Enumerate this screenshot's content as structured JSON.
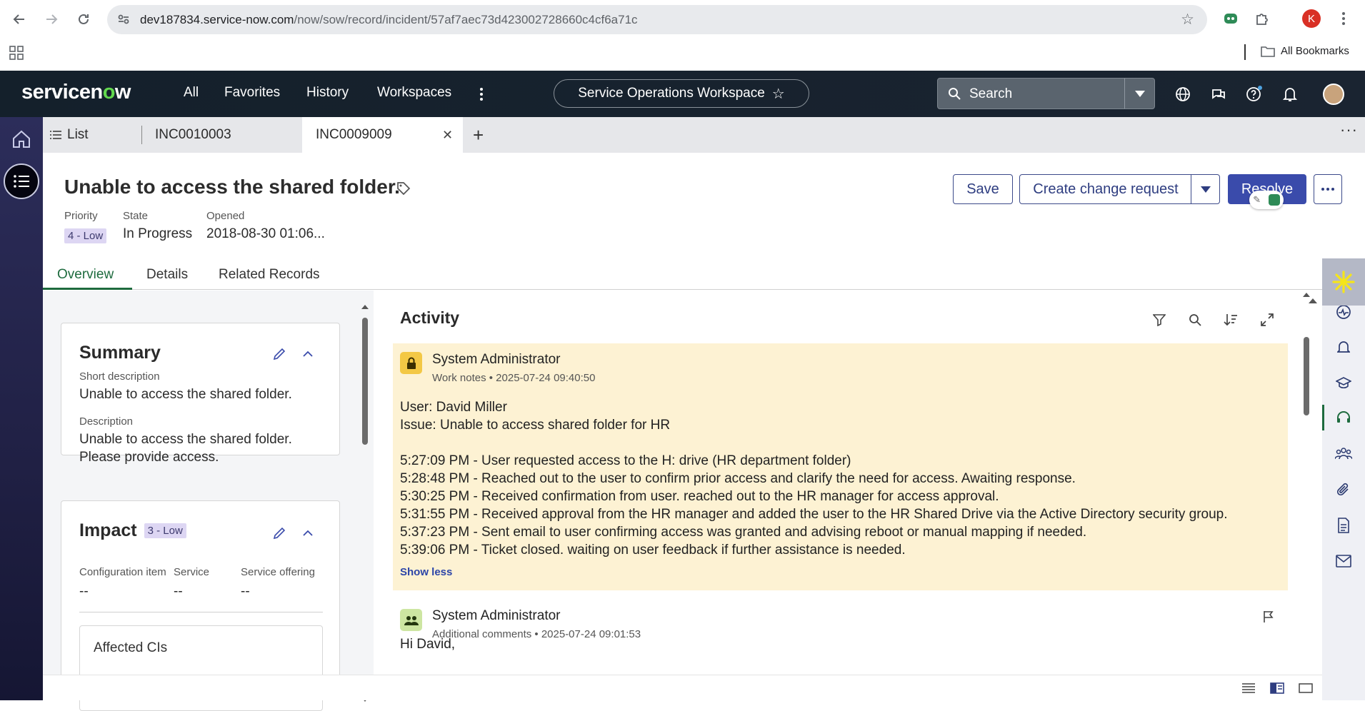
{
  "browser": {
    "url_host": "dev187834.service-now.com",
    "url_path": "/now/sow/record/incident/57af7aec73d423002728660c4cf6a71c",
    "profile_initial": "K",
    "all_bookmarks_label": "All Bookmarks"
  },
  "header": {
    "logo": "servicenow",
    "nav": [
      "All",
      "Favorites",
      "History",
      "Workspaces"
    ],
    "workspace_name": "Service Operations Workspace",
    "search_label": "Search"
  },
  "tabs": {
    "list_label": "List",
    "tab1": "INC0010003",
    "tab2": "INC0009009"
  },
  "record": {
    "title": "Unable to access the shared folder.",
    "priority_label": "Priority",
    "priority_value": "4 - Low",
    "state_label": "State",
    "state_value": "In Progress",
    "opened_label": "Opened",
    "opened_value": "2018-08-30 01:06...",
    "buttons": {
      "save": "Save",
      "create_change": "Create change request",
      "resolve": "Resolve"
    },
    "subtabs": [
      "Overview",
      "Details",
      "Related Records"
    ]
  },
  "summary": {
    "heading": "Summary",
    "short_desc_label": "Short description",
    "short_desc_value": "Unable to access the shared folder.",
    "desc_label": "Description",
    "desc_value": "Unable to access the shared folder.\nPlease provide access."
  },
  "impact": {
    "heading": "Impact",
    "badge": "3 - Low",
    "ci_label": "Configuration item",
    "ci_value": "--",
    "service_label": "Service",
    "service_value": "--",
    "offering_label": "Service offering",
    "offering_value": "--",
    "affected_cis": "Affected CIs"
  },
  "activity": {
    "title": "Activity",
    "entries": [
      {
        "author": "System Administrator",
        "subtitle": "Work notes • 2025-07-24 09:40:50",
        "body": "User: David Miller\nIssue: Unable to access shared folder for HR\n\n5:27:09 PM - User requested access to the H: drive (HR department folder)\n5:28:48 PM - Reached out to the user to confirm prior access and clarify the need for access. Awaiting response.\n5:30:25 PM - Received confirmation from user. reached out to the HR manager for access approval.\n5:31:55 PM - Received approval from the HR manager and added the user to the HR Shared Drive via the Active Directory security group.\n5:37:23 PM - Sent email to user confirming access was granted and advising reboot or manual mapping if needed.\n5:39:06 PM - Ticket closed. waiting on user feedback if further assistance is needed.",
        "show_less": "Show less"
      },
      {
        "author": "System Administrator",
        "subtitle": "Additional comments • 2025-07-24 09:01:53",
        "body": "Hi David,"
      }
    ]
  },
  "colors": {
    "header_bg": "#14202b",
    "rail_bg": "#2c2d5a",
    "primary": "#3a4bab",
    "work_note_bg": "#fdf2d3",
    "accent_green": "#1e6b3e"
  }
}
